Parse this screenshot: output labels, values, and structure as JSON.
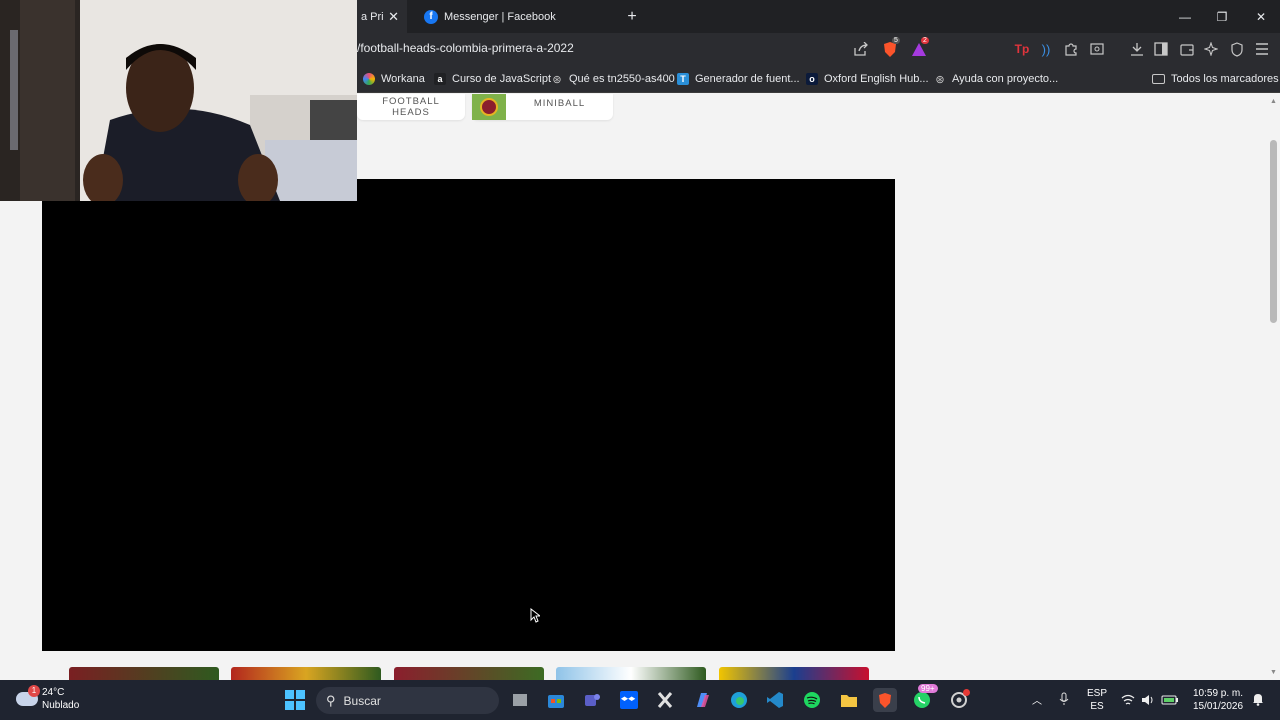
{
  "browser": {
    "tabs": [
      {
        "label": "a Pri",
        "active": true
      },
      {
        "label": "Messenger | Facebook",
        "active": false
      }
    ],
    "new_tab_label": "+",
    "window_controls": {
      "minimize": "—",
      "maximize": "❐",
      "close": "✕"
    },
    "url": "/football-heads-colombia-primera-a-2022",
    "shield_count": "5",
    "alert_count": "2",
    "bookmarks": [
      {
        "label": "Workana",
        "icon": "workana-icon"
      },
      {
        "label": "Curso de JavaScript",
        "icon": "a-icon"
      },
      {
        "label": "Qué es tn2550-as400",
        "icon": "openai-icon"
      },
      {
        "label": "Generador de fuent...",
        "icon": "font-icon"
      },
      {
        "label": "Oxford English Hub...",
        "icon": "oxford-icon"
      },
      {
        "label": "Ayuda con proyecto...",
        "icon": "openai-icon"
      }
    ],
    "all_bookmarks_label": "Todos los marcadores"
  },
  "page": {
    "game_cards": [
      {
        "label": "FOOTBALL HEADS"
      },
      {
        "label": "MINIBALL"
      }
    ]
  },
  "taskbar": {
    "weather": {
      "temp": "24°C",
      "condition": "Nublado",
      "badge": "1"
    },
    "search_placeholder": "Buscar",
    "whatsapp_badge": "99+",
    "language": {
      "line1": "ESP",
      "line2": "ES"
    },
    "clock": {
      "time": "10:59 p. m.",
      "date": "15/01/2026"
    }
  }
}
